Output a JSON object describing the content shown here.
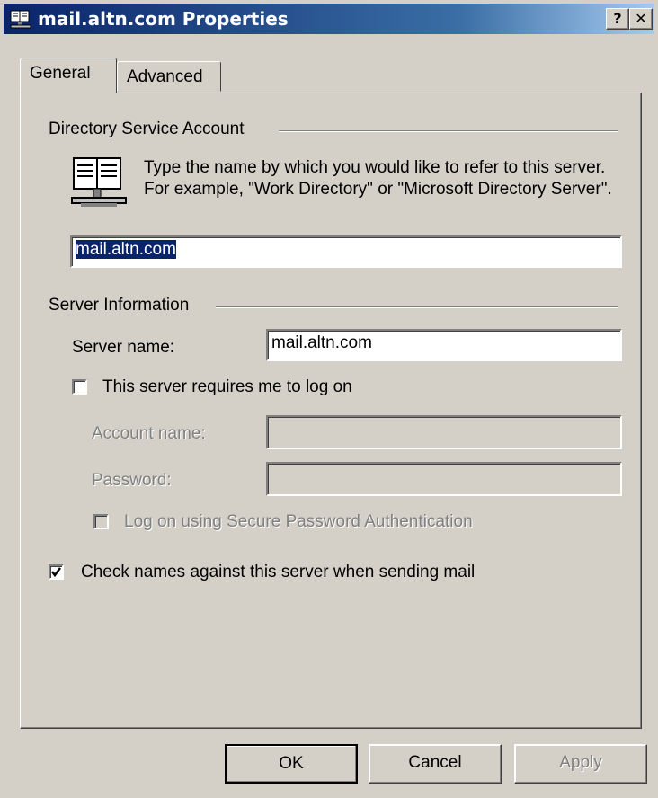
{
  "window": {
    "title": "mail.altn.com Properties",
    "help_glyph": "?",
    "close_glyph": "✕"
  },
  "tabs": [
    {
      "label": "General",
      "active": true
    },
    {
      "label": "Advanced",
      "active": false
    }
  ],
  "directory_account": {
    "group_label": "Directory Service Account",
    "description": "Type the name by which you would like to refer to this server. For example, \"Work Directory\" or \"Microsoft Directory Server\".",
    "name_value": "mail.altn.com"
  },
  "server_info": {
    "group_label": "Server Information",
    "server_name_label": "Server name:",
    "server_name_value": "mail.altn.com",
    "requires_logon_label": "This server requires me to log on",
    "requires_logon_checked": false,
    "account_name_label": "Account name:",
    "account_name_value": "",
    "password_label": "Password:",
    "password_value": "",
    "spa_label": "Log on using Secure Password Authentication",
    "spa_checked": false
  },
  "check_names": {
    "label": "Check names against this server when sending mail",
    "checked": true
  },
  "buttons": {
    "ok": "OK",
    "cancel": "Cancel",
    "apply": "Apply"
  },
  "icons": {
    "title": "address-book-icon",
    "directory": "directory-book-icon"
  },
  "colors": {
    "title_gradient_start": "#0a246a",
    "title_gradient_end": "#a6caf0",
    "face": "#d4d0c8",
    "selection": "#0a246a"
  }
}
